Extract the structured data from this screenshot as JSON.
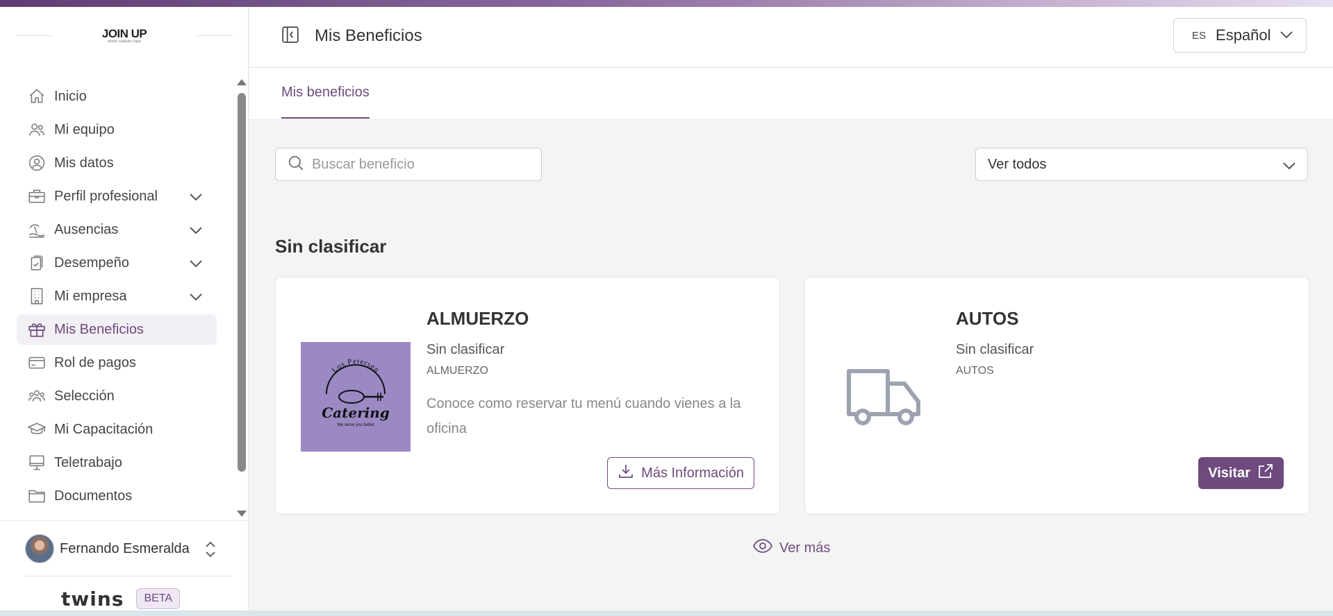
{
  "brand": {
    "logo_text": "JOIN UP",
    "logo_sub": "desde cualquier lugar",
    "product": "twins",
    "beta": "BETA"
  },
  "sidebar": {
    "items": [
      {
        "label": "Inicio",
        "icon": "home-icon",
        "expandable": false,
        "active": false
      },
      {
        "label": "Mi equipo",
        "icon": "team-icon",
        "expandable": false,
        "active": false
      },
      {
        "label": "Mis datos",
        "icon": "user-circle-icon",
        "expandable": false,
        "active": false
      },
      {
        "label": "Perfil profesional",
        "icon": "briefcase-icon",
        "expandable": true,
        "active": false
      },
      {
        "label": "Ausencias",
        "icon": "beach-icon",
        "expandable": true,
        "active": false
      },
      {
        "label": "Desempeño",
        "icon": "clipboard-check-icon",
        "expandable": true,
        "active": false
      },
      {
        "label": "Mi empresa",
        "icon": "building-icon",
        "expandable": true,
        "active": false
      },
      {
        "label": "Mis Beneficios",
        "icon": "gift-icon",
        "expandable": false,
        "active": true
      },
      {
        "label": "Rol de pagos",
        "icon": "credit-card-icon",
        "expandable": false,
        "active": false
      },
      {
        "label": "Selección",
        "icon": "users-icon",
        "expandable": false,
        "active": false
      },
      {
        "label": "Mi Capacitación",
        "icon": "graduation-cap-icon",
        "expandable": false,
        "active": false
      },
      {
        "label": "Teletrabajo",
        "icon": "monitor-icon",
        "expandable": false,
        "active": false
      },
      {
        "label": "Documentos",
        "icon": "folder-icon",
        "expandable": false,
        "active": false
      }
    ],
    "user_name": "Fernando Esmeralda"
  },
  "header": {
    "title": "Mis Beneficios",
    "lang_code": "ES",
    "lang_name": "Español"
  },
  "tabs": [
    {
      "label": "Mis beneficios",
      "active": true
    }
  ],
  "filters": {
    "search_placeholder": "Buscar beneficio",
    "select_value": "Ver todos"
  },
  "section": {
    "title": "Sin clasificar"
  },
  "cards": [
    {
      "name": "ALMUERZO",
      "category": "Sin clasificar",
      "subtitle": "ALMUERZO",
      "description": "Conoce como reservar tu menú cuando vienes a la oficina",
      "button": "Más Información",
      "logo_top": "Los Petersen",
      "logo_main": "Catering",
      "logo_tag": "We serve you better"
    },
    {
      "name": "AUTOS",
      "category": "Sin clasificar",
      "subtitle": "AUTOS",
      "description": "",
      "button": "Visitar"
    }
  ],
  "ver_mas": "Ver más",
  "colors": {
    "accent": "#6e4a7e",
    "catering_bg": "#9b89c4"
  }
}
